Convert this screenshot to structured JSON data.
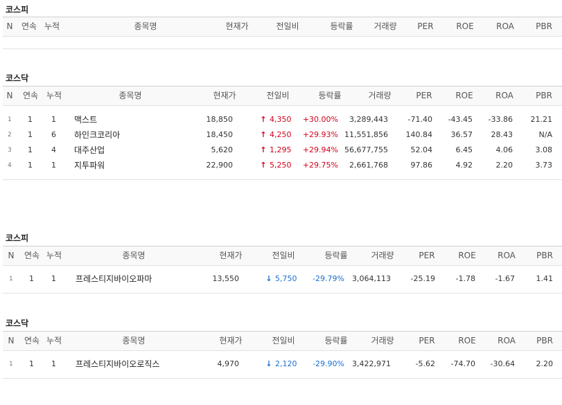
{
  "columns": [
    "N",
    "연속",
    "누적",
    "종목명",
    "현재가",
    "전일비",
    "등락률",
    "거래량",
    "PER",
    "ROE",
    "ROA",
    "PBR"
  ],
  "sections": [
    {
      "title": "코스피",
      "rows": []
    },
    {
      "title": "코스닥",
      "rows": [
        {
          "n": "1",
          "cont": "1",
          "cum": "1",
          "name": "맥스트",
          "price": "18,850",
          "dir": "up",
          "change": "4,350",
          "rate": "+30.00%",
          "volume": "3,289,443",
          "per": "-71.40",
          "roe": "-43.45",
          "roa": "-33.86",
          "pbr": "21.21"
        },
        {
          "n": "2",
          "cont": "1",
          "cum": "6",
          "name": "하인크코리아",
          "price": "18,450",
          "dir": "up",
          "change": "4,250",
          "rate": "+29.93%",
          "volume": "11,551,856",
          "per": "140.84",
          "roe": "36.57",
          "roa": "28.43",
          "pbr": "N/A"
        },
        {
          "n": "3",
          "cont": "1",
          "cum": "4",
          "name": "대주산업",
          "price": "5,620",
          "dir": "up",
          "change": "1,295",
          "rate": "+29.94%",
          "volume": "56,677,755",
          "per": "52.04",
          "roe": "6.45",
          "roa": "4.06",
          "pbr": "3.08"
        },
        {
          "n": "4",
          "cont": "1",
          "cum": "1",
          "name": "지투파워",
          "price": "22,900",
          "dir": "up",
          "change": "5,250",
          "rate": "+29.75%",
          "volume": "2,661,768",
          "per": "97.86",
          "roe": "4.92",
          "roa": "2.20",
          "pbr": "3.73"
        }
      ]
    },
    {
      "title": "코스피",
      "rows": [
        {
          "n": "1",
          "cont": "1",
          "cum": "1",
          "name": "프레스티지바이오파마",
          "price": "13,550",
          "dir": "down",
          "change": "5,750",
          "rate": "-29.79%",
          "volume": "3,064,113",
          "per": "-25.19",
          "roe": "-1.78",
          "roa": "-1.67",
          "pbr": "1.41"
        }
      ]
    },
    {
      "title": "코스닥",
      "rows": [
        {
          "n": "1",
          "cont": "1",
          "cum": "1",
          "name": "프레스티지바이오로직스",
          "price": "4,970",
          "dir": "down",
          "change": "2,120",
          "rate": "-29.90%",
          "volume": "3,422,971",
          "per": "-5.62",
          "roe": "-74.70",
          "roa": "-30.64",
          "pbr": "2.20"
        }
      ]
    }
  ],
  "icons": {
    "up": "up-arrow-icon",
    "down": "down-arrow-icon"
  },
  "colors": {
    "up": "#d0021b",
    "down": "#1a6fd0",
    "header_bg": "#f9f9f9"
  }
}
